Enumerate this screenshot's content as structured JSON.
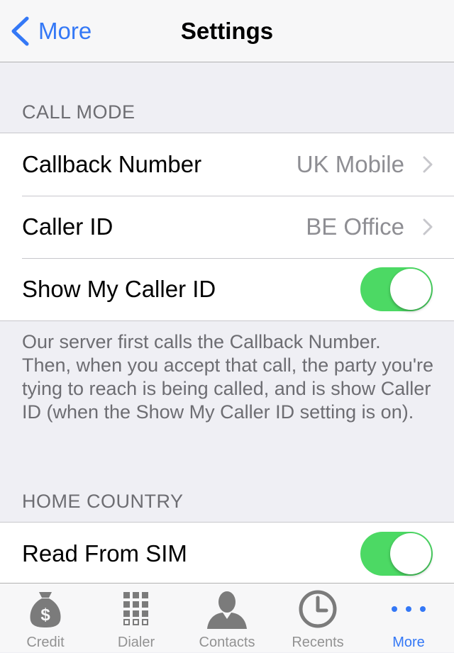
{
  "navbar": {
    "back_label": "More",
    "title": "Settings"
  },
  "call_mode": {
    "header": "CALL MODE",
    "rows": [
      {
        "label": "Callback Number",
        "value": "UK Mobile"
      },
      {
        "label": "Caller ID",
        "value": "BE Office"
      },
      {
        "label": "Show My Caller ID",
        "toggle_on": true
      }
    ],
    "footer": "Our server first calls the Callback Number. Then, when you accept that call, the party you're tying to reach is being called, and is show Caller ID (when the Show My Caller ID setting is on)."
  },
  "home_country": {
    "header": "HOME COUNTRY",
    "rows": [
      {
        "label": "Read From SIM",
        "toggle_on": true
      }
    ]
  },
  "tabbar": {
    "tabs": [
      {
        "label": "Credit",
        "icon": "money-bag-icon"
      },
      {
        "label": "Dialer",
        "icon": "keypad-icon"
      },
      {
        "label": "Contacts",
        "icon": "person-icon"
      },
      {
        "label": "Recents",
        "icon": "clock-icon"
      },
      {
        "label": "More",
        "icon": "more-dots-icon",
        "active": true
      }
    ]
  },
  "colors": {
    "accent": "#3478f6",
    "toggle_on": "#4cd964",
    "background": "#efeff4"
  }
}
